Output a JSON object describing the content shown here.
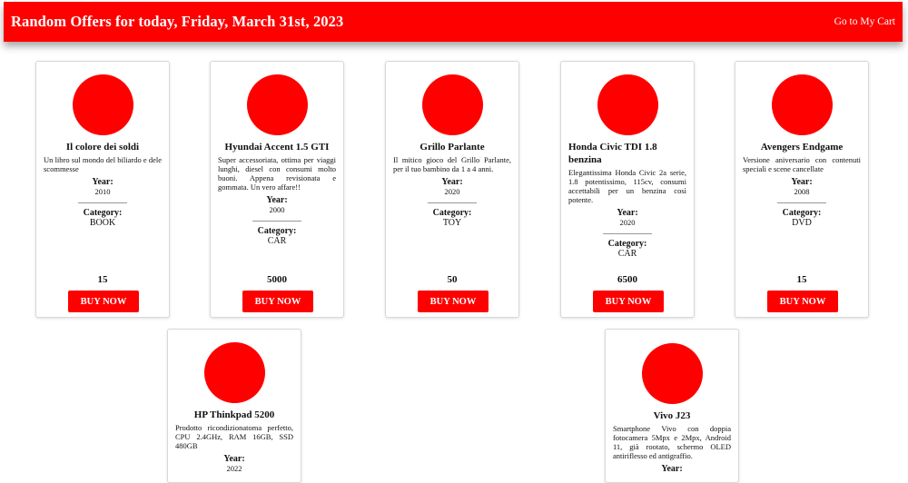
{
  "header": {
    "title": "Random Offers for today, Friday, March 31st, 2023",
    "cart_link": "Go to My Cart"
  },
  "labels": {
    "year": "Year:",
    "category": "Category:",
    "buy": "BUY NOW"
  },
  "colors": {
    "accent": "#ff0000"
  },
  "products": [
    {
      "name": "Il colore dei soldi",
      "description": "Un libro sul mondo del biliardo e dele scommesse",
      "year": "2010",
      "category": "BOOK",
      "price": "15"
    },
    {
      "name": "Hyundai Accent 1.5 GTI",
      "description": "Super accessoriata, ottima per viaggi lunghi, diesel con consumi molto buoni. Appena revisionata e gommata. Un vero affare!!",
      "year": "2000",
      "category": "CAR",
      "price": "5000"
    },
    {
      "name": "Grillo Parlante",
      "description": "Il mitico gioco del Grillo Parlante, per il tuo bambino da 1 a 4 anni.",
      "year": "2020",
      "category": "TOY",
      "price": "50"
    },
    {
      "name": "Honda Civic TDI 1.8 benzina",
      "description": "Elegantissima Honda Civic 2a serie, 1.8 potentissimo, 115cv, consumi accettabili per un benzina così potente.",
      "year": "2020",
      "category": "CAR",
      "price": "6500"
    },
    {
      "name": "Avengers Endgame",
      "description": "Versione aniversario con contenuti speciali e scene cancellate",
      "year": "2008",
      "category": "DVD",
      "price": "15"
    },
    {
      "name": "HP Thinkpad 5200",
      "description": "Prodotto ricondizionatoma perfetto, CPU 2.4GHz, RAM 16GB, SSD 480GB",
      "year": "2022"
    },
    {
      "name": "Vivo J23",
      "description": "Smartphone Vivo con doppia fotocamera 5Mpx e 2Mpx, Android 11, già rootato, schermo OLED antiriflesso ed antigraffio."
    }
  ]
}
